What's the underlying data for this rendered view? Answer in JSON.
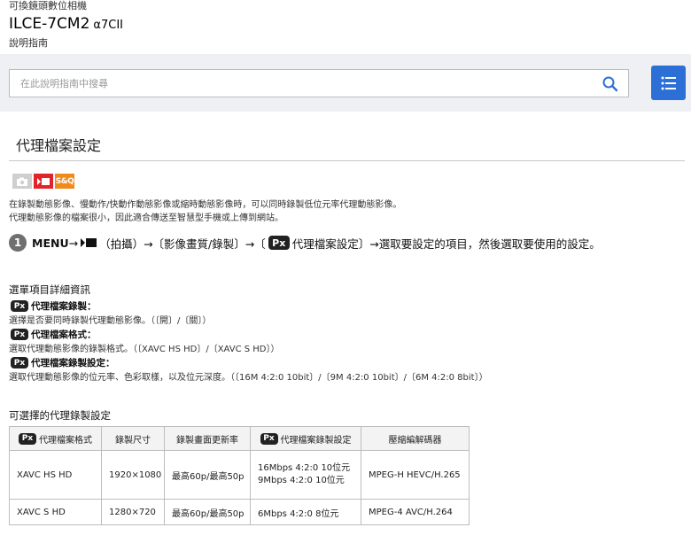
{
  "header": {
    "subtitle": "可換鏡頭數位相機",
    "model": "ILCE-7CM2",
    "model_alpha": "α7CII",
    "guide": "說明指南"
  },
  "search": {
    "placeholder": "在此說明指南中搜尋"
  },
  "page": {
    "title": "代理檔案設定",
    "mode_sq_label": "S&Q",
    "desc_line1": "在錄製動態影像、慢動作/快動作動態影像或縮時動態影像時，可以同時錄製低位元率代理動態影像。",
    "desc_line2": "代理動態影像的檔案很小，因此適合傳送至智慧型手機或上傳到網站。"
  },
  "step": {
    "number": "1",
    "menu": "MENU",
    "arrow1": "→",
    "text1": "（拍攝）→〔影像畫質/錄製〕→〔",
    "px_label": "Px",
    "text2": "代理檔案設定〕→選取要設定的項目，然後選取要使用的設定。"
  },
  "menu_details": {
    "title": "選單項目詳細資訊",
    "items": [
      {
        "px": "Px",
        "label": "代理檔案錄製：",
        "desc": "選擇是否要同時錄製代理動態影像。（〔開〕/〔關〕）"
      },
      {
        "px": "Px",
        "label": "代理檔案格式：",
        "desc": "選取代理動態影像的錄製格式。（〔XAVC HS HD〕/〔XAVC S HD〕）"
      },
      {
        "px": "Px",
        "label": "代理檔案錄製設定：",
        "desc": "選取代理動態影像的位元率、色彩取樣，以及位元深度。（〔16M 4:2:0 10bit〕/〔9M 4:2:0 10bit〕/〔6M 4:2:0 8bit〕）"
      }
    ]
  },
  "table": {
    "title": "可選擇的代理錄製設定",
    "headers": {
      "px": "Px",
      "format": "代理檔案格式",
      "size": "錄製尺寸",
      "rate": "錄製畫面更新率",
      "setting": "代理檔案錄製設定",
      "codec": "壓縮編解碼器"
    },
    "rows": [
      {
        "format": "XAVC HS HD",
        "size": "1920×1080",
        "rate": "最高60p/最高50p",
        "setting_1": "16Mbps 4:2:0 10位元",
        "setting_2": "9Mbps 4:2:0 10位元",
        "codec": "MPEG-H HEVC/H.265"
      },
      {
        "format": "XAVC S HD",
        "size": "1280×720",
        "rate": "最高60p/最高50p",
        "setting_1": "6Mbps 4:2:0 8位元",
        "codec": "MPEG-4 AVC/H.264"
      }
    ]
  },
  "colors": {
    "menu_button": "#2c6fd6",
    "search_band": "#eef0f3",
    "movie_icon": "#e2232a",
    "sq_icon": "#f08a1c",
    "photo_icon": "#cfcfcf"
  },
  "icons": [
    "search-icon",
    "list-menu-icon",
    "photo-mode-icon",
    "movie-mode-icon",
    "sq-mode-icon",
    "movie-camera-icon"
  ]
}
